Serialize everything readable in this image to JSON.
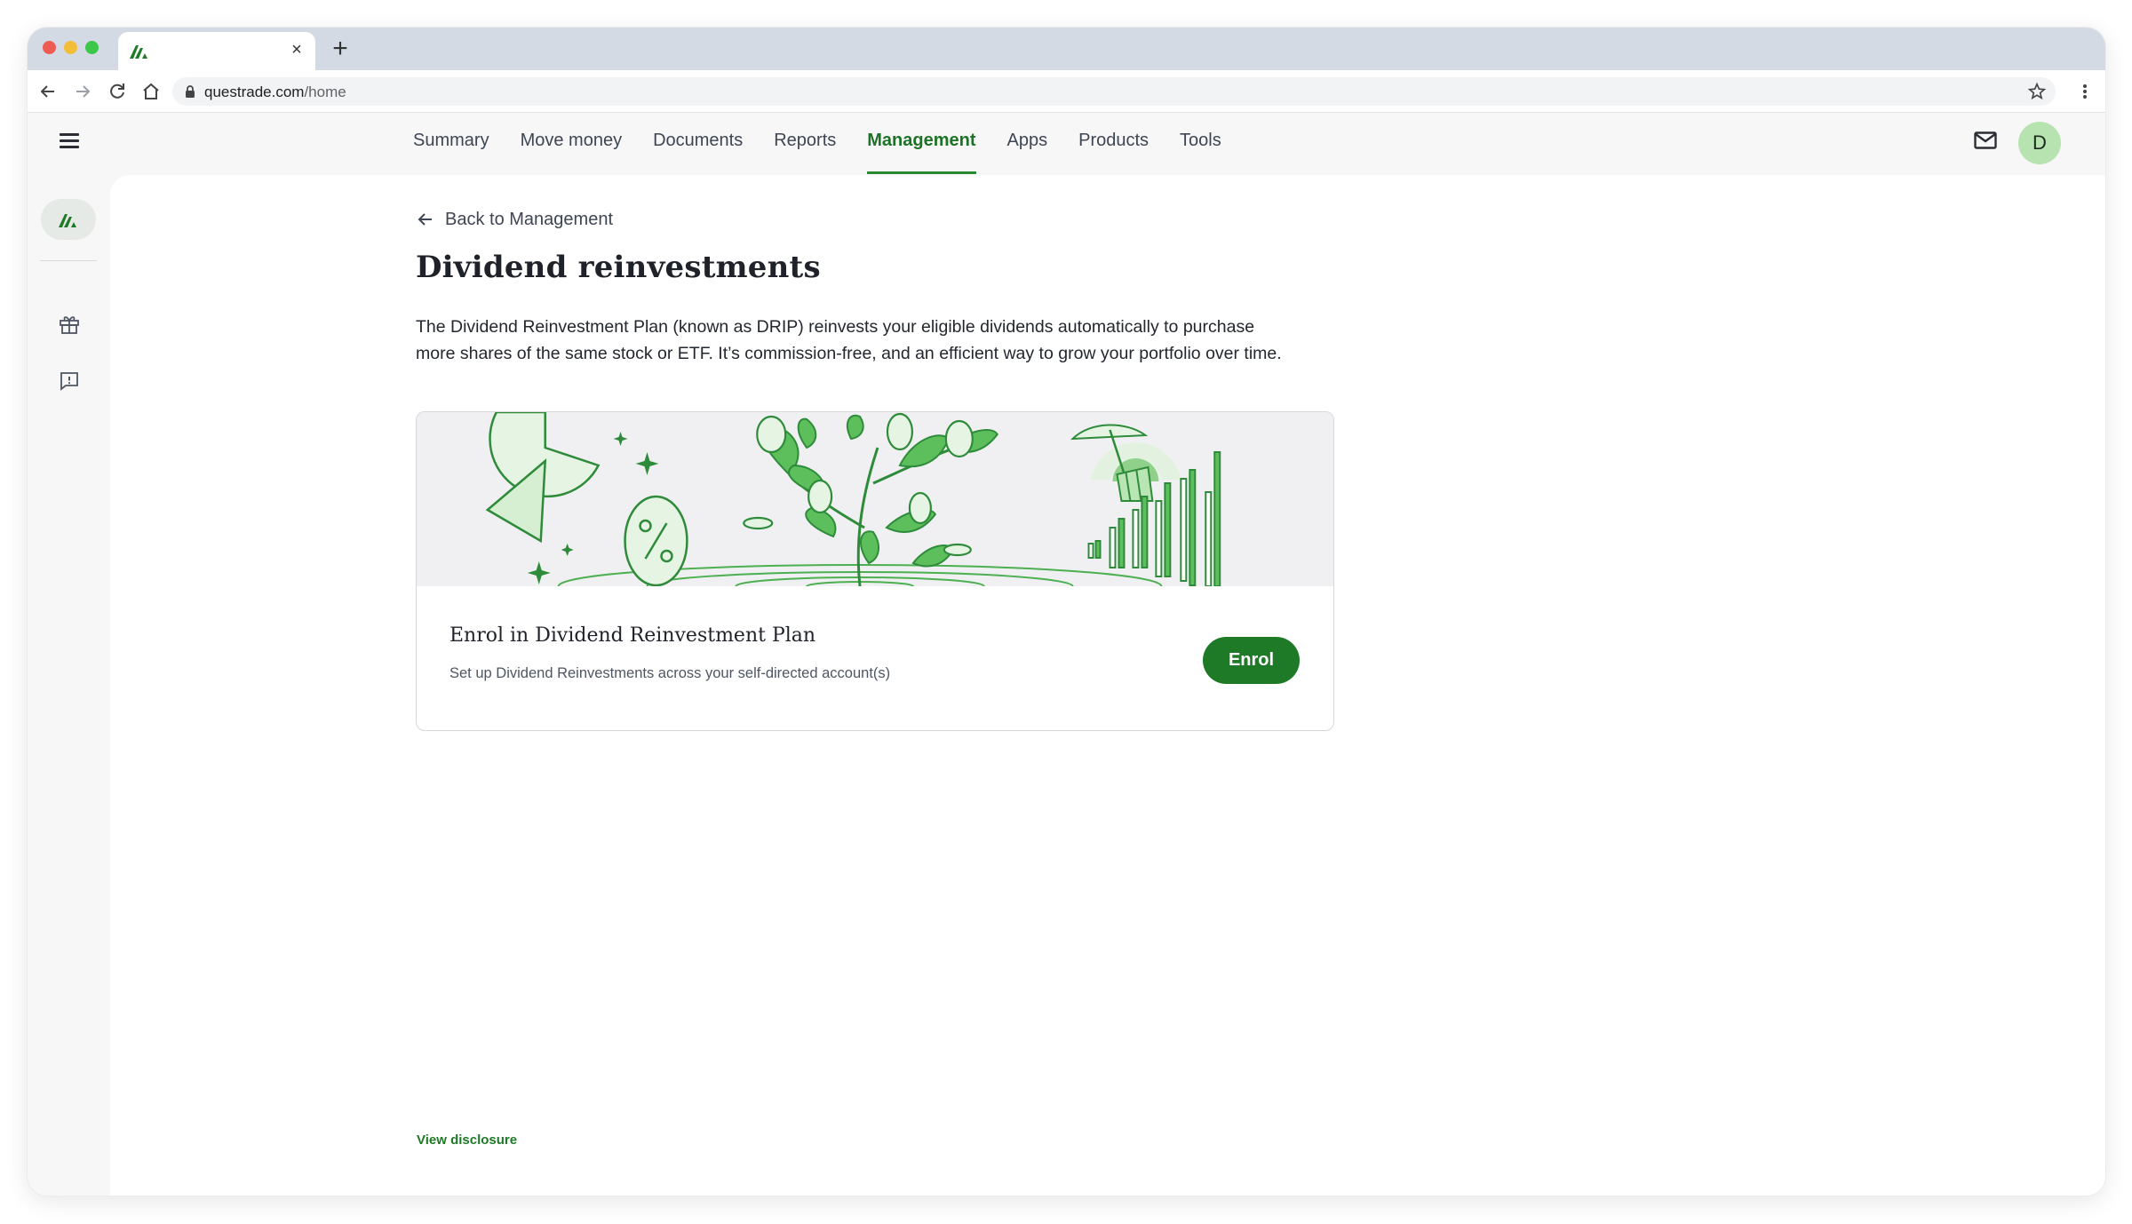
{
  "browser": {
    "tab_close": "×",
    "new_tab": "+",
    "url_host": "questrade.com",
    "url_path": "/home",
    "icons": [
      "back-arrow-icon",
      "forward-arrow-icon",
      "reload-icon",
      "home-icon",
      "lock-icon",
      "star-icon",
      "kebab-menu-icon"
    ]
  },
  "nav": {
    "items": [
      {
        "label": "Summary",
        "active": false
      },
      {
        "label": "Move money",
        "active": false
      },
      {
        "label": "Documents",
        "active": false
      },
      {
        "label": "Reports",
        "active": false
      },
      {
        "label": "Management",
        "active": true
      },
      {
        "label": "Apps",
        "active": false
      },
      {
        "label": "Products",
        "active": false
      },
      {
        "label": "Tools",
        "active": false
      }
    ],
    "avatar_initial": "D"
  },
  "page": {
    "back_label": "Back to Management",
    "title": "Dividend reinvestments",
    "description_line1": "The Dividend Reinvestment Plan (known as DRIP) reinvests your eligible dividends automatically to purchase",
    "description_line2": "more shares of the same stock or ETF. It’s commission-free, and an efficient way to grow your portfolio over time.",
    "card": {
      "title": "Enrol in Dividend Reinvestment Plan",
      "subtitle": "Set up Dividend Reinvestments across your self-directed account(s)",
      "button": "Enrol"
    },
    "disclosure_link": "View disclosure"
  },
  "colors": {
    "brand_green": "#1e7a26",
    "active_nav": "#1d7325",
    "avatar_bg": "#b7e3b0",
    "illustration_bg": "#f0f0f3"
  }
}
